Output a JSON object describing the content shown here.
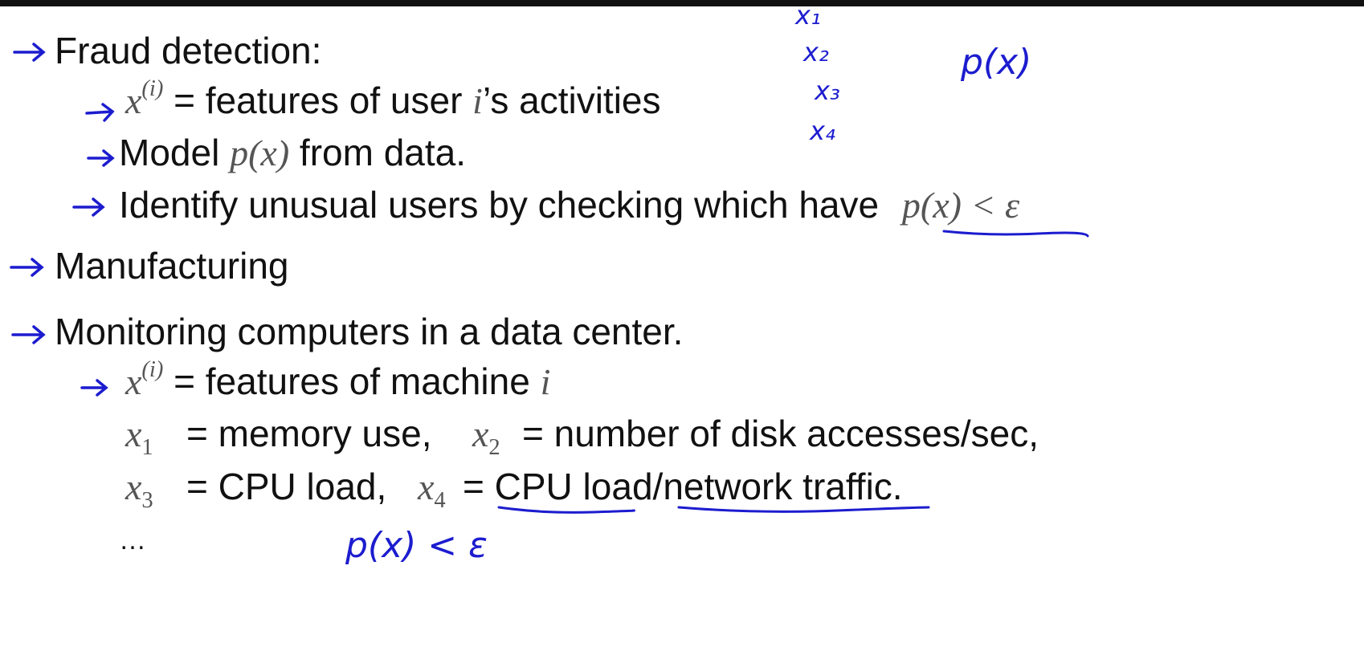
{
  "slide": {
    "lines": {
      "fraud": "Fraud detection:",
      "features_user_a": "= features of user ",
      "features_user_b": "’s activities",
      "model_a": "Model ",
      "model_b": " from data.",
      "identify": "Identify unusual users by checking which have ",
      "manufacturing": "Manufacturing",
      "monitoring": "Monitoring computers in a data center.",
      "features_machine": "= features of machine ",
      "memory": "= memory use,",
      "disk": "= number of disk accesses/sec,",
      "cpu": "= CPU load,",
      "cpu_net_eq": "= ",
      "cpu_load": "CPU load",
      "slash": "/",
      "network_traffic": "network traffic",
      "period": ".",
      "ellipsis": "…"
    },
    "math": {
      "x": "x",
      "sup_i": "(i)",
      "i": "i",
      "px": "p(x)",
      "px_eps": "p(x) < ε",
      "x1": "x",
      "x1_sub": "1",
      "x2": "x",
      "x2_sub": "2",
      "x3": "x",
      "x3_sub": "3",
      "x4": "x",
      "x4_sub": "4"
    },
    "handwriting": {
      "x1": "x₁",
      "x2": "x₂",
      "x3": "x₃",
      "x4": "x₄",
      "px": "p(x)",
      "px_eps": "p(x) < ε"
    },
    "colors": {
      "ink": "#1c1ccf",
      "text": "#111111",
      "math": "#555555"
    }
  }
}
